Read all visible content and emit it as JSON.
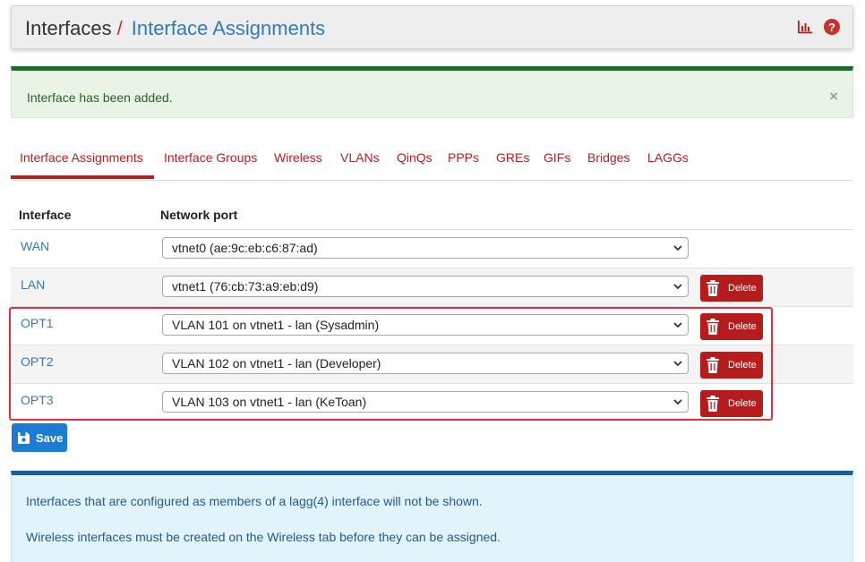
{
  "header": {
    "breadcrumb_root": "Interfaces",
    "breadcrumb_separator": "/",
    "breadcrumb_current": "Interface Assignments",
    "icons": [
      "bar-chart-icon",
      "help-icon"
    ],
    "help_glyph": "?"
  },
  "alert": {
    "message": "Interface has been added.",
    "close_glyph": "×"
  },
  "tabs": [
    {
      "label": "Interface Assignments",
      "active": true
    },
    {
      "label": "Interface Groups"
    },
    {
      "label": "Wireless"
    },
    {
      "label": "VLANs"
    },
    {
      "label": "QinQs"
    },
    {
      "label": "PPPs"
    },
    {
      "label": "GREs"
    },
    {
      "label": "GIFs"
    },
    {
      "label": "Bridges"
    },
    {
      "label": "LAGGs"
    }
  ],
  "table": {
    "headers": {
      "interface": "Interface",
      "network_port": "Network port"
    },
    "rows": [
      {
        "interface": "WAN",
        "port": "vtnet0 (ae:9c:eb:c6:87:ad)"
      },
      {
        "interface": "LAN",
        "port": "vtnet1 (76:cb:73:a9:eb:d9)",
        "delete_label": "Delete"
      },
      {
        "interface": "OPT1",
        "port": "VLAN 101 on vtnet1 - lan (Sysadmin)",
        "delete_label": "Delete"
      },
      {
        "interface": "OPT2",
        "port": "VLAN 102 on vtnet1 - lan (Developer)",
        "delete_label": "Delete"
      },
      {
        "interface": "OPT3",
        "port": "VLAN 103 on vtnet1 - lan (KeToan)",
        "delete_label": "Delete"
      }
    ]
  },
  "save_label": "Save",
  "info": {
    "line1": "Interfaces that are configured as members of a lagg(4) interface will not be shown.",
    "line2": "Wireless interfaces must be created on the Wireless tab before they can be assigned."
  },
  "colors": {
    "accent_red": "#b22222",
    "link_blue": "#337ab7",
    "save_blue": "#1e7bd4",
    "highlight_red": "#e53040"
  }
}
